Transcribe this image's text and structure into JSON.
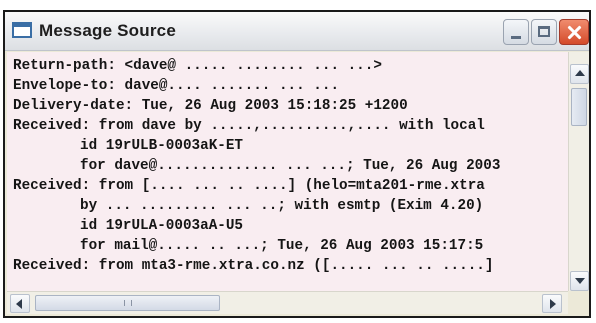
{
  "window": {
    "title": "Message Source",
    "icons": {
      "app": "window-icon",
      "minimize": "minimize-icon",
      "maximize": "maximize-icon",
      "close": "close-icon"
    },
    "colors": {
      "content_background": "#f9edf1",
      "text": "#151515",
      "close_button": "#d44a2a"
    }
  },
  "message": {
    "lines": [
      {
        "text": "Return-path: <dave@ ..... ........ ... ...>",
        "indent": false
      },
      {
        "text": "Envelope-to: dave@.... ....... ... ...",
        "indent": false
      },
      {
        "text": "Delivery-date: Tue, 26 Aug 2003 15:18:25 +1200",
        "indent": false
      },
      {
        "text": "Received: from dave by .....,..........,.... with local",
        "indent": false
      },
      {
        "text": "id 19rULB-0003aK-ET",
        "indent": true
      },
      {
        "text": "for dave@.............. ... ...; Tue, 26 Aug 2003",
        "indent": true
      },
      {
        "text": "Received: from [.... ... .. ....] (helo=mta201-rme.xtra",
        "indent": false
      },
      {
        "text": "by ... ......... ... ..; with esmtp (Exim 4.20)",
        "indent": true
      },
      {
        "text": "id 19rULA-0003aA-U5",
        "indent": true
      },
      {
        "text": "for mail@..... .. ...; Tue, 26 Aug 2003 15:17:5",
        "indent": true
      },
      {
        "text": "Received: from mta3-rme.xtra.co.nz ([..... ... .. .....]",
        "indent": false
      }
    ]
  },
  "scrollbars": {
    "vertical": {
      "up_icon": "arrow-up-icon",
      "down_icon": "arrow-down-icon"
    },
    "horizontal": {
      "left_icon": "arrow-left-icon",
      "right_icon": "arrow-right-icon"
    }
  }
}
